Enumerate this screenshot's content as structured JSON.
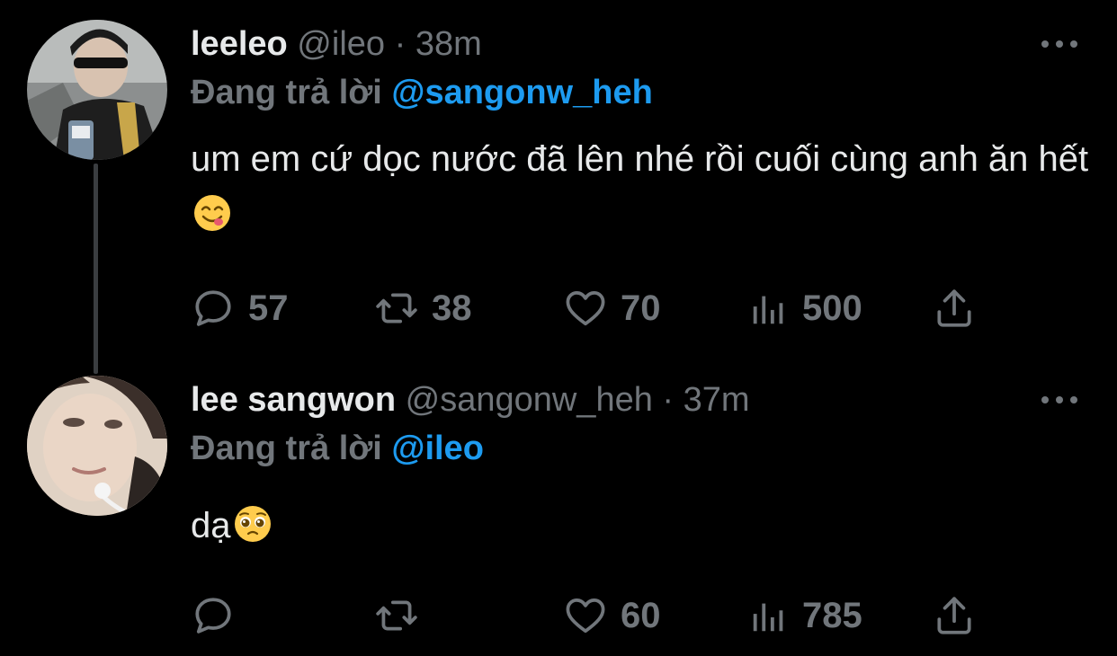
{
  "tweets": [
    {
      "display_name": "leeleo",
      "handle": "@ileo",
      "separator": "·",
      "time": "38m",
      "reply_label": "Đang trả lời",
      "reply_mention": "@sangonw_heh",
      "text": "um em cứ dọc nước đã lên nhé rồi cuối cùng anh ăn hết",
      "emoji": "face-savoring-food",
      "metrics": {
        "replies": "57",
        "retweets": "38",
        "likes": "70",
        "views": "500"
      }
    },
    {
      "display_name": "lee sangwon",
      "handle": "@sangonw_heh",
      "separator": "·",
      "time": "37m",
      "reply_label": "Đang trả lời",
      "reply_mention": "@ileo",
      "text": "dạ",
      "emoji": "pleading-face",
      "metrics": {
        "replies": "",
        "retweets": "",
        "likes": "60",
        "views": "785"
      }
    }
  ],
  "icons": {
    "reply": "reply-icon",
    "retweet": "retweet-icon",
    "like": "heart-icon",
    "views": "views-icon",
    "share": "share-icon",
    "more": "more-icon"
  },
  "colors": {
    "background": "#000000",
    "text": "#e7e9ea",
    "muted": "#71767b",
    "mention": "#1d9bf0",
    "thread_line": "#3a3d40"
  }
}
